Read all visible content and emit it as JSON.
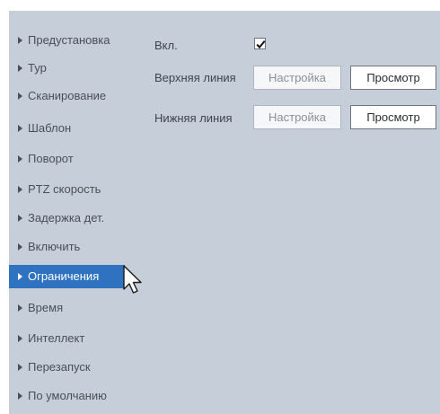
{
  "sidebar": {
    "items": [
      {
        "label": "Предустановка"
      },
      {
        "label": "Тур"
      },
      {
        "label": "Сканирование"
      },
      {
        "label": "Шаблон"
      },
      {
        "label": "Поворот"
      },
      {
        "label": "PTZ скорость"
      },
      {
        "label": "Задержка дет."
      },
      {
        "label": "Включить"
      },
      {
        "label": "Ограничения"
      },
      {
        "label": "Время"
      },
      {
        "label": "Интеллект"
      },
      {
        "label": "Перезапуск"
      },
      {
        "label": "По умолчанию"
      }
    ],
    "active_index": 8
  },
  "main": {
    "enable": {
      "label": "Вкл.",
      "checked": true
    },
    "upper_line": {
      "label": "Верхняя линия",
      "setup_label": "Настройка",
      "preview_label": "Просмотр"
    },
    "lower_line": {
      "label": "Нижняя линия",
      "setup_label": "Настройка",
      "preview_label": "Просмотр"
    }
  },
  "colors": {
    "panel_bg": "#c6ced9",
    "active_item_bg": "#2f73c0",
    "active_item_text": "#ffffff"
  }
}
